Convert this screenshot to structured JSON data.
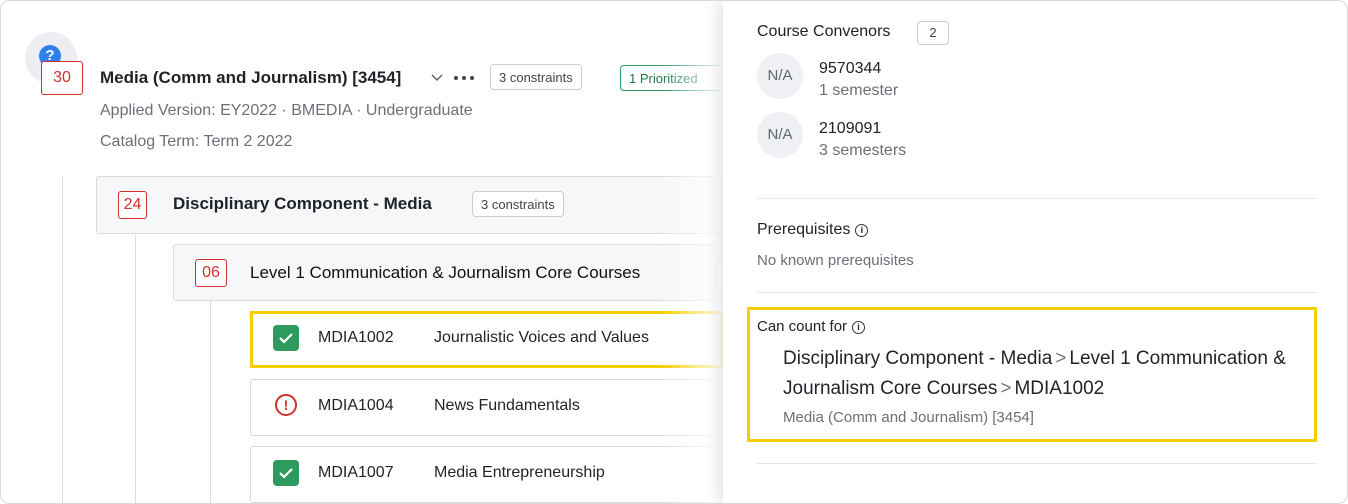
{
  "program": {
    "badge": "30",
    "title": "Media (Comm and Journalism) [3454]",
    "constraints_chip": "3 constraints",
    "prioritized_chip": "1 Prioritized",
    "meta_line": "Applied Version: EY2022 · BMEDIA · Undergraduate",
    "catalog_term": "Catalog Term: Term 2 2022"
  },
  "component": {
    "badge": "24",
    "title": "Disciplinary Component - Media",
    "constraints_chip": "3 constraints"
  },
  "subcomponent": {
    "badge": "06",
    "title": "Level 1 Communication & Journalism Core Courses"
  },
  "courses": [
    {
      "code": "MDIA1002",
      "name": "Journalistic Voices and Values",
      "status": "complete"
    },
    {
      "code": "MDIA1004",
      "name": "News Fundamentals",
      "status": "warning"
    },
    {
      "code": "MDIA1007",
      "name": "Media Entrepreneurship",
      "status": "complete"
    }
  ],
  "panel": {
    "convenors_label": "Course Convenors",
    "convenors_count": "2",
    "convenors": [
      {
        "avatar": "N/A",
        "id": "9570344",
        "semesters": "1 semester"
      },
      {
        "avatar": "N/A",
        "id": "2109091",
        "semesters": "3 semesters"
      }
    ],
    "prereq_label": "Prerequisites",
    "prereq_value": "No known prerequisites",
    "can_count_label": "Can count for",
    "path": [
      "Disciplinary Component - Media",
      "Level 1 Communication & Journalism Core Courses",
      "MDIA1002"
    ],
    "path_sub": "Media (Comm and Journalism) [3454]"
  },
  "colors": {
    "accent_red": "#d0312d",
    "success_green": "#2e9a5e",
    "highlight": "#f4d000",
    "help_blue": "#2f80ed"
  },
  "icons": [
    "help-icon",
    "chevron-down-icon",
    "more-icon",
    "check-icon",
    "alert-icon",
    "info-icon",
    "chevron-right-icon"
  ]
}
